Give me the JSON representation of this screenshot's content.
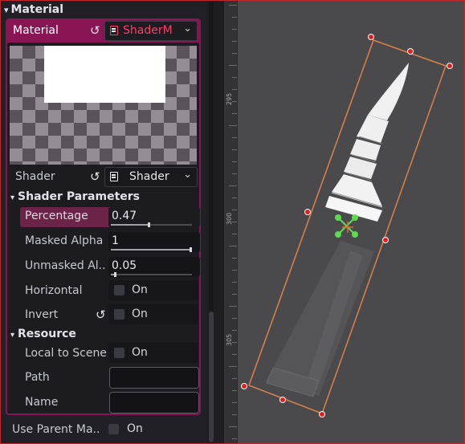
{
  "inspector": {
    "section_title": "Material",
    "material": {
      "label": "Material",
      "resource_name": "ShaderM"
    },
    "shader": {
      "label": "Shader",
      "resource_name": "Shader"
    },
    "shader_parameters": {
      "title": "Shader Parameters",
      "percentage": {
        "label": "Percentage",
        "value": "0.47",
        "fraction": 0.47
      },
      "masked_alpha": {
        "label": "Masked Alpha",
        "value": "1",
        "fraction": 1.0
      },
      "unmasked_alpha": {
        "label": "Unmasked Al...",
        "value": "0.05",
        "fraction": 0.05
      },
      "horizontal": {
        "label": "Horizontal",
        "state": "On"
      },
      "invert": {
        "label": "Invert",
        "state": "On"
      }
    },
    "resource": {
      "title": "Resource",
      "local_to_scene": {
        "label": "Local to Scene",
        "state": "On"
      },
      "path": {
        "label": "Path",
        "value": ""
      },
      "name": {
        "label": "Name",
        "value": ""
      }
    },
    "use_parent_material": {
      "label": "Use Parent Ma...",
      "state": "On"
    }
  },
  "viewport": {
    "ruler_labels": [
      "295",
      "300",
      "305"
    ],
    "colors": {
      "background": "#4a4a4c",
      "selection_box": "#d9834a",
      "handle": "#e02020",
      "pivot": "#5bdc4e"
    }
  },
  "colors": {
    "accent": "#8a1555",
    "highlight_row": "#6c2348",
    "resource_red": "#ff3d6a"
  }
}
